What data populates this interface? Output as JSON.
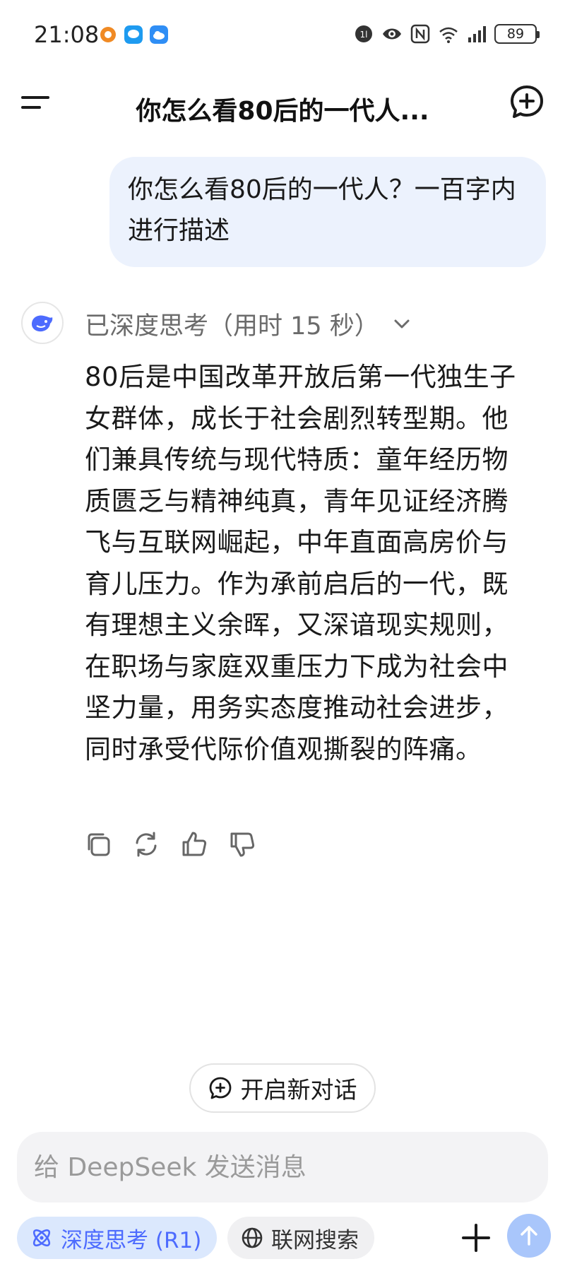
{
  "status_bar": {
    "time": "21:08",
    "battery": "89"
  },
  "header": {
    "title": "你怎么看80后的一代人..."
  },
  "user_message": {
    "text": "你怎么看80后的一代人？一百字内进行描述"
  },
  "assistant": {
    "thought_label": "已深度思考（用时 15 秒）",
    "answer": "80后是中国改革开放后第一代独生子女群体，成长于社会剧烈转型期。他们兼具传统与现代特质：童年经历物质匮乏与精神纯真，青年见证经济腾飞与互联网崛起，中年直面高房价与育儿压力。作为承前启后的一代，既有理想主义余晖，又深谙现实规则，在职场与家庭双重压力下成为社会中坚力量，用务实态度推动社会进步，同时承受代际价值观撕裂的阵痛。"
  },
  "new_conversation": {
    "label": "开启新对话"
  },
  "composer": {
    "placeholder": "给 DeepSeek 发送消息"
  },
  "toolbar": {
    "deepthink_label": "深度思考 (R1)",
    "search_label": "联网搜索"
  },
  "colors": {
    "accent": "#4d6bfe",
    "bubble": "#ecf2fd",
    "send": "#a9c6fb"
  }
}
